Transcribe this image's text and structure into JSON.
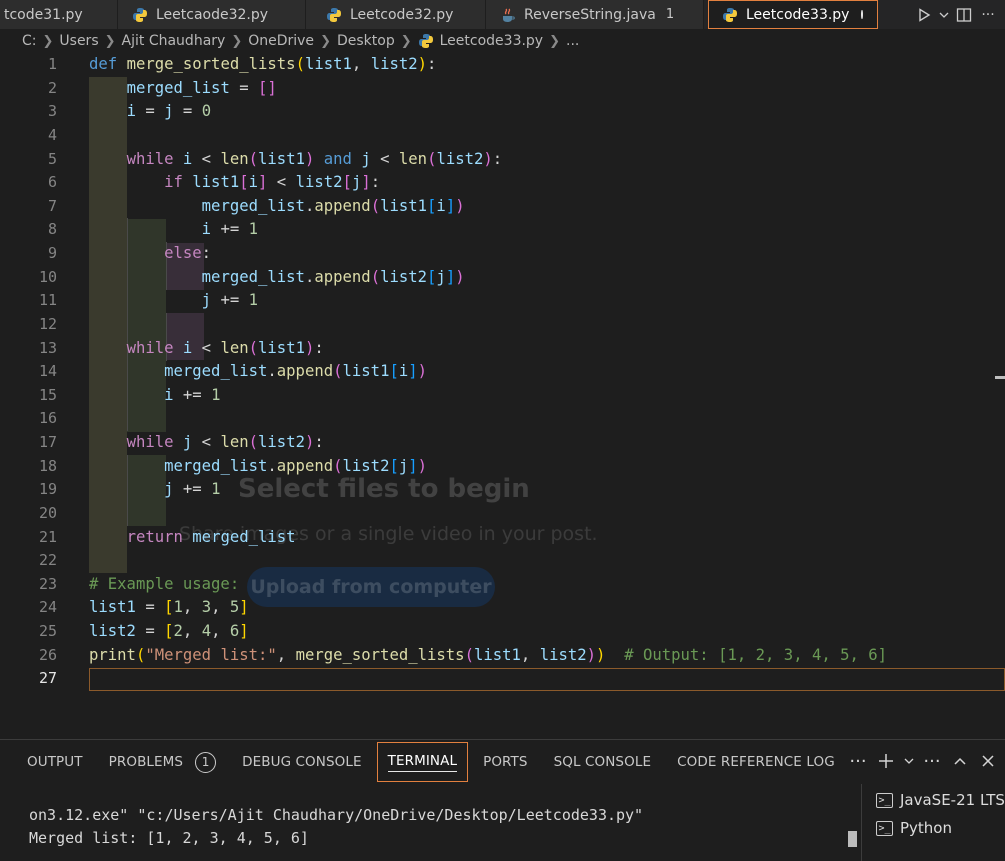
{
  "tabs": [
    {
      "label": "tcode31.py",
      "icon": "python-file-icon"
    },
    {
      "label": "Leetcaode32.py",
      "icon": "python-file-icon"
    },
    {
      "label": "Leetcode32.py",
      "icon": "python-file-icon"
    },
    {
      "label": "ReverseString.java",
      "icon": "java-file-icon",
      "badge": "1"
    },
    {
      "label": "Leetcode33.py",
      "icon": "python-file-icon",
      "active": true,
      "modified": true
    }
  ],
  "breadcrumb": [
    "C:",
    "Users",
    "Ajit Chaudhary",
    "OneDrive",
    "Desktop",
    "Leetcode33.py",
    "..."
  ],
  "editor": {
    "line_numbers": [
      "1",
      "2",
      "3",
      "4",
      "5",
      "6",
      "7",
      "8",
      "9",
      "10",
      "11",
      "12",
      "13",
      "14",
      "15",
      "16",
      "17",
      "18",
      "19",
      "20",
      "21",
      "22",
      "23",
      "24",
      "25",
      "26",
      "27"
    ],
    "current_line": "27"
  },
  "background_overlay": {
    "title": "Select files to begin",
    "subtitle": "Share images or a single video in your post.",
    "button": "Upload from computer"
  },
  "panel": {
    "tabs": [
      {
        "label": "OUTPUT"
      },
      {
        "label": "PROBLEMS",
        "badge": "1"
      },
      {
        "label": "DEBUG CONSOLE"
      },
      {
        "label": "TERMINAL",
        "active": true
      },
      {
        "label": "PORTS"
      },
      {
        "label": "SQL CONSOLE"
      },
      {
        "label": "CODE REFERENCE LOG"
      }
    ],
    "terminal_lines": [
      "on3.12.exe\" \"c:/Users/Ajit Chaudhary/OneDrive/Desktop/Leetcode33.py\"",
      "Merged list: [1, 2, 3, 4, 5, 6]"
    ],
    "terminals": [
      "JavaSE-21 LTS",
      "Python"
    ]
  },
  "colors": {
    "accent_border": "#e2803f",
    "keyword": "#569cd6",
    "control": "#c586c0",
    "function": "#dcdcaa",
    "variable": "#9cdcfe",
    "number": "#b5cea8",
    "string": "#ce9178",
    "comment": "#6a9955"
  }
}
